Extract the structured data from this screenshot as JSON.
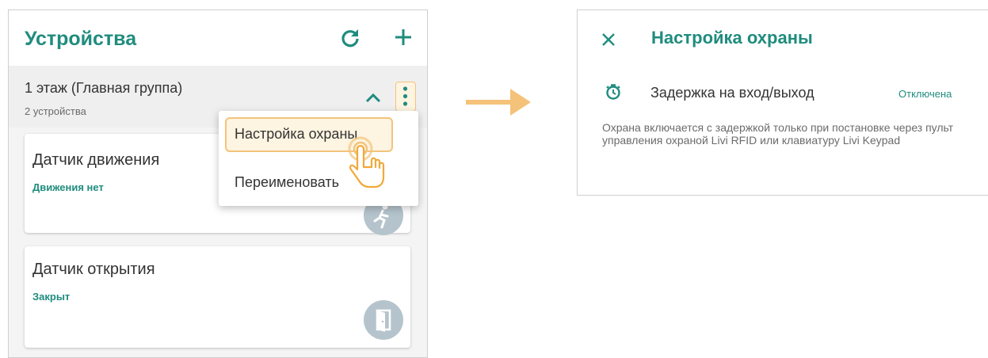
{
  "left": {
    "title": "Устройства",
    "group": {
      "title": "1 этаж (Главная группа)",
      "subtitle": "2 устройства"
    },
    "menu": {
      "items": [
        "Настройка охраны",
        "Переименовать"
      ]
    },
    "devices": [
      {
        "name": "Датчик движения",
        "status": "Движения нет",
        "icon": "running-person-icon"
      },
      {
        "name": "Датчик открытия",
        "status": "Закрыт",
        "icon": "door-icon"
      }
    ]
  },
  "right": {
    "title": "Настройка охраны",
    "setting": {
      "label": "Задержка на вход/выход",
      "value": "Отключена"
    },
    "note": "Охрана включается с задержкой только при постановке через пульт управления охраной Livi RFID или клавиатуру Livi Keypad"
  },
  "colors": {
    "accent": "#1f8c7e",
    "highlight": "#f3c37a",
    "arrow": "#f5c27a",
    "badge": "#b5c4cc"
  }
}
